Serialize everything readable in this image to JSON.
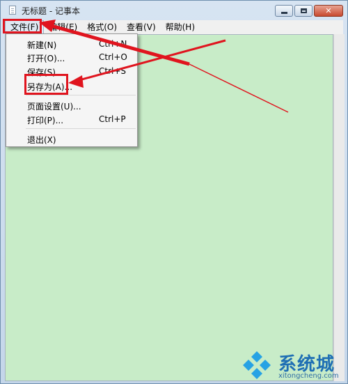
{
  "window": {
    "title": "无标题 - 记事本"
  },
  "menubar": {
    "items": [
      {
        "label": "文件(F)"
      },
      {
        "label": "编辑(E)"
      },
      {
        "label": "格式(O)"
      },
      {
        "label": "查看(V)"
      },
      {
        "label": "帮助(H)"
      }
    ]
  },
  "file_menu": {
    "items": [
      {
        "label": "新建(N)",
        "shortcut": "Ctrl+N"
      },
      {
        "label": "打开(O)...",
        "shortcut": "Ctrl+O"
      },
      {
        "label": "保存(S)",
        "shortcut": "Ctrl+S"
      },
      {
        "label": "另存为(A)...",
        "shortcut": ""
      },
      {
        "label": "页面设置(U)...",
        "shortcut": ""
      },
      {
        "label": "打印(P)...",
        "shortcut": "Ctrl+P"
      },
      {
        "label": "退出(X)",
        "shortcut": ""
      }
    ]
  },
  "colors": {
    "editor_bg": "#c8ecc8",
    "annotation": "#e0141e",
    "watermark": "#1f6fb4"
  },
  "watermark": {
    "brand": "系统城",
    "url": "xitongcheng.com"
  }
}
